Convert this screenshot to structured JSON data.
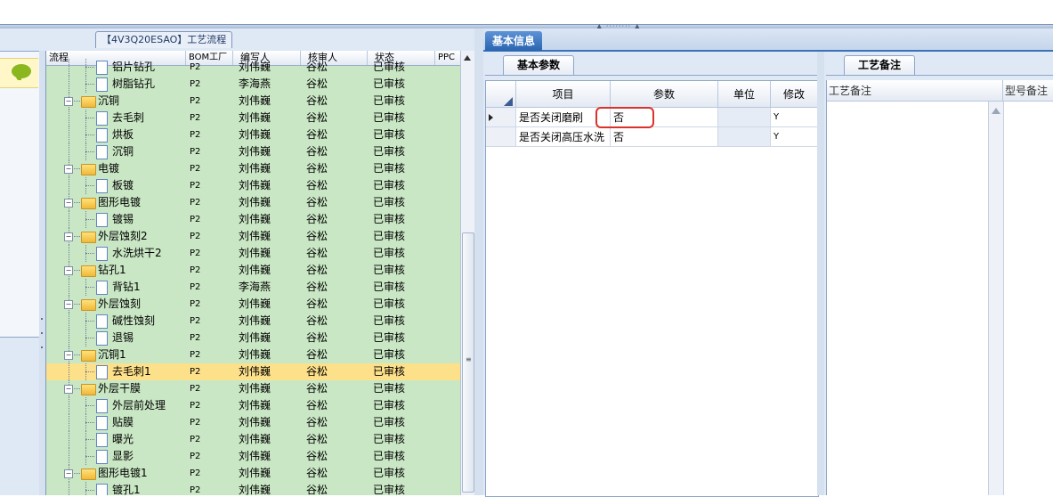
{
  "process_tab": "【4V3Q20ESAO】工艺流程",
  "tree": {
    "columns": [
      "流程",
      "BOM工厂",
      "编写人",
      "核审人",
      "状态",
      "PPC"
    ],
    "rows": [
      {
        "level": 2,
        "type": "doc",
        "name": "铝片钻孔",
        "factory": "P2",
        "writer": "刘伟巍",
        "checker": "谷松",
        "status": "已审核"
      },
      {
        "level": 2,
        "type": "doc",
        "name": "树脂钻孔",
        "factory": "P2",
        "writer": "李海燕",
        "checker": "谷松",
        "status": "已审核"
      },
      {
        "level": 1,
        "type": "folder",
        "name": "沉铜",
        "factory": "P2",
        "writer": "刘伟巍",
        "checker": "谷松",
        "status": "已审核"
      },
      {
        "level": 2,
        "type": "doc",
        "name": "去毛刺",
        "factory": "P2",
        "writer": "刘伟巍",
        "checker": "谷松",
        "status": "已审核"
      },
      {
        "level": 2,
        "type": "doc",
        "name": "烘板",
        "factory": "P2",
        "writer": "刘伟巍",
        "checker": "谷松",
        "status": "已审核"
      },
      {
        "level": 2,
        "type": "doc",
        "name": "沉铜",
        "factory": "P2",
        "writer": "刘伟巍",
        "checker": "谷松",
        "status": "已审核"
      },
      {
        "level": 1,
        "type": "folder",
        "name": "电镀",
        "factory": "P2",
        "writer": "刘伟巍",
        "checker": "谷松",
        "status": "已审核"
      },
      {
        "level": 2,
        "type": "doc",
        "name": "板镀",
        "factory": "P2",
        "writer": "刘伟巍",
        "checker": "谷松",
        "status": "已审核"
      },
      {
        "level": 1,
        "type": "folder",
        "name": "图形电镀",
        "factory": "P2",
        "writer": "刘伟巍",
        "checker": "谷松",
        "status": "已审核"
      },
      {
        "level": 2,
        "type": "doc",
        "name": "镀锡",
        "factory": "P2",
        "writer": "刘伟巍",
        "checker": "谷松",
        "status": "已审核"
      },
      {
        "level": 1,
        "type": "folder",
        "name": "外层蚀刻2",
        "factory": "P2",
        "writer": "刘伟巍",
        "checker": "谷松",
        "status": "已审核"
      },
      {
        "level": 2,
        "type": "doc",
        "name": "水洗烘干2",
        "factory": "P2",
        "writer": "刘伟巍",
        "checker": "谷松",
        "status": "已审核"
      },
      {
        "level": 1,
        "type": "folder",
        "name": "钻孔1",
        "factory": "P2",
        "writer": "刘伟巍",
        "checker": "谷松",
        "status": "已审核"
      },
      {
        "level": 2,
        "type": "doc",
        "name": "背钻1",
        "factory": "P2",
        "writer": "李海燕",
        "checker": "谷松",
        "status": "已审核"
      },
      {
        "level": 1,
        "type": "folder",
        "name": "外层蚀刻",
        "factory": "P2",
        "writer": "刘伟巍",
        "checker": "谷松",
        "status": "已审核"
      },
      {
        "level": 2,
        "type": "doc",
        "name": "碱性蚀刻",
        "factory": "P2",
        "writer": "刘伟巍",
        "checker": "谷松",
        "status": "已审核"
      },
      {
        "level": 2,
        "type": "doc",
        "name": "退锡",
        "factory": "P2",
        "writer": "刘伟巍",
        "checker": "谷松",
        "status": "已审核"
      },
      {
        "level": 1,
        "type": "folder",
        "name": "沉铜1",
        "factory": "P2",
        "writer": "刘伟巍",
        "checker": "谷松",
        "status": "已审核"
      },
      {
        "level": 2,
        "type": "doc",
        "name": "去毛刺1",
        "factory": "P2",
        "writer": "刘伟巍",
        "checker": "谷松",
        "status": "已审核",
        "selected": true
      },
      {
        "level": 1,
        "type": "folder",
        "name": "外层干膜",
        "factory": "P2",
        "writer": "刘伟巍",
        "checker": "谷松",
        "status": "已审核"
      },
      {
        "level": 2,
        "type": "doc",
        "name": "外层前处理",
        "factory": "P2",
        "writer": "刘伟巍",
        "checker": "谷松",
        "status": "已审核"
      },
      {
        "level": 2,
        "type": "doc",
        "name": "贴膜",
        "factory": "P2",
        "writer": "刘伟巍",
        "checker": "谷松",
        "status": "已审核"
      },
      {
        "level": 2,
        "type": "doc",
        "name": "曝光",
        "factory": "P2",
        "writer": "刘伟巍",
        "checker": "谷松",
        "status": "已审核"
      },
      {
        "level": 2,
        "type": "doc",
        "name": "显影",
        "factory": "P2",
        "writer": "刘伟巍",
        "checker": "谷松",
        "status": "已审核"
      },
      {
        "level": 1,
        "type": "folder",
        "name": "图形电镀1",
        "factory": "P2",
        "writer": "刘伟巍",
        "checker": "谷松",
        "status": "已审核"
      },
      {
        "level": 2,
        "type": "doc",
        "name": "镀孔1",
        "factory": "P2",
        "writer": "刘伟巍",
        "checker": "谷松",
        "status": "已审核"
      }
    ]
  },
  "right": {
    "main_tab": "基本信息",
    "basic_tab": "基本参数",
    "notes_tab": "工艺备注",
    "grid_headers": [
      "项目",
      "参数",
      "单位",
      "修改"
    ],
    "grid_rows": [
      {
        "item": "是否关闭磨刷",
        "param": "否",
        "unit": "",
        "modified": "Y",
        "current": true
      },
      {
        "item": "是否关闭高压水洗",
        "param": "否",
        "unit": "",
        "modified": "Y",
        "current": false
      }
    ],
    "notes_headers": [
      "工艺备注",
      "型号备注"
    ]
  },
  "colors": {
    "tree_bg": "#c9e7c4",
    "selected_row": "#fde08a",
    "tab_blue": "#2a64b0",
    "highlight_red": "#d9332b"
  }
}
